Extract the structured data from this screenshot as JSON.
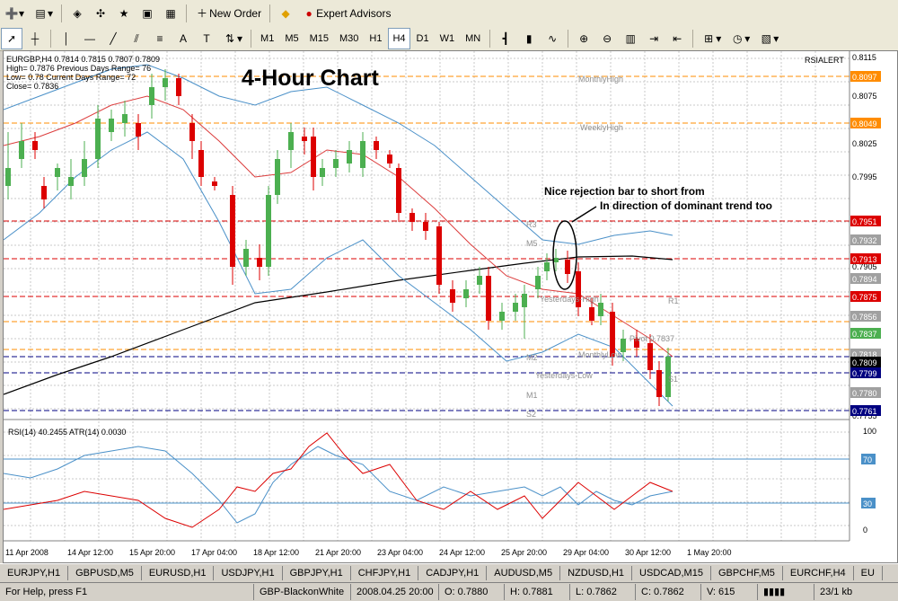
{
  "toolbar1": {
    "new_order": "New Order",
    "expert_advisors": "Expert Advisors"
  },
  "toolbar2": {
    "timeframes": [
      "M1",
      "M5",
      "M15",
      "M30",
      "H1",
      "H4",
      "D1",
      "W1",
      "MN"
    ],
    "active_timeframe": "H4"
  },
  "chart": {
    "info_line": "EURGBP,H4  0.7814 0.7815 0.7807 0.7809",
    "info_lines": [
      "High= 0.7876   Previous Days Range= 76",
      "Low= 0.78    Current Days Range= 72",
      "Close= 0.7836"
    ],
    "title": "4-Hour Chart",
    "indicator_tag": "RSIALERT",
    "annotation_line1": "Nice rejection bar to short from",
    "annotation_line2": "In direction of dominant trend too",
    "levels": [
      "MonthlyHigh",
      "WeeklyHigh",
      "R3",
      "M5",
      "R1",
      "Yesterdays-High",
      "Pivot 0.7837",
      "MonthlyLow",
      "M2",
      "Yesterdays-Low",
      "S1",
      "M1",
      "S2"
    ],
    "price_axis": [
      "0.8115",
      "0.8097",
      "0.8075",
      "0.8049",
      "0.8025",
      "0.7995",
      "0.7951",
      "0.7932",
      "0.7913",
      "0.7905",
      "0.7894",
      "0.7875",
      "0.7856",
      "0.7837",
      "0.7818",
      "0.7809",
      "0.7799",
      "0.7780",
      "0.7761",
      "0.7755"
    ],
    "price_badges": [
      {
        "label": "0.8097",
        "color": "#ff8c00"
      },
      {
        "label": "0.8049",
        "color": "#ff8c00"
      },
      {
        "label": "0.7951",
        "color": "#dc0000"
      },
      {
        "label": "0.7932",
        "color": "#a0a0a0"
      },
      {
        "label": "0.7913",
        "color": "#dc0000"
      },
      {
        "label": "0.7894",
        "color": "#a0a0a0"
      },
      {
        "label": "0.7875",
        "color": "#dc0000"
      },
      {
        "label": "0.7856",
        "color": "#a0a0a0"
      },
      {
        "label": "0.7837",
        "color": "#4caf50"
      },
      {
        "label": "0.7818",
        "color": "#a0a0a0"
      },
      {
        "label": "0.7809",
        "color": "#000000"
      },
      {
        "label": "0.7799",
        "color": "#000080"
      },
      {
        "label": "0.7780",
        "color": "#a0a0a0"
      },
      {
        "label": "0.7761",
        "color": "#000080"
      }
    ],
    "time_axis": [
      "11 Apr 2008",
      "14 Apr 12:00",
      "15 Apr 20:00",
      "17 Apr 04:00",
      "18 Apr 12:00",
      "21 Apr 20:00",
      "23 Apr 04:00",
      "24 Apr 12:00",
      "25 Apr 20:00",
      "29 Apr 04:00",
      "30 Apr 12:00",
      "1 May 20:00"
    ],
    "rsi_label": "RSI(14) 40.2455   ATR(14) 0.0030",
    "rsi_axis": [
      "100",
      "70",
      "30",
      "0"
    ]
  },
  "tabs": [
    "EURJPY,H1",
    "GBPUSD,M5",
    "EURUSD,H1",
    "USDJPY,H1",
    "GBPJPY,H1",
    "CHFJPY,H1",
    "CADJPY,H1",
    "AUDUSD,M5",
    "NZDUSD,H1",
    "USDCAD,M15",
    "GBPCHF,M5",
    "EURCHF,H4",
    "EU"
  ],
  "status": {
    "help": "For Help, press F1",
    "profile": "GBP-BlackonWhite",
    "time": "2008.04.25 20:00",
    "open": "O: 0.7880",
    "high": "H: 0.7881",
    "low": "L: 0.7862",
    "close": "C: 0.7862",
    "volume": "V: 615",
    "conn": "23/1 kb"
  },
  "colors": {
    "bull": "#4caf50",
    "bear": "#dc0000",
    "bands": "#4a90c8",
    "ma": "#dc3c3c",
    "longma": "#000000",
    "rsi": "#4a90c8",
    "atr": "#dc0000"
  }
}
